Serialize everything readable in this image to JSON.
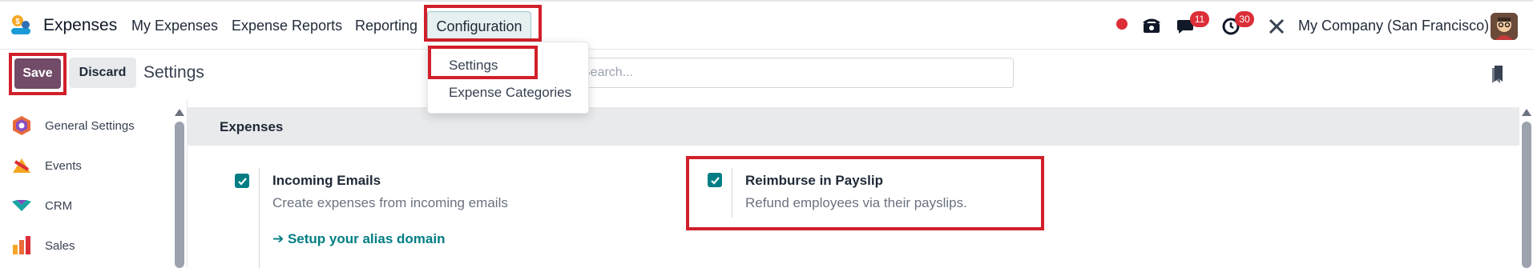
{
  "navbar": {
    "app_name": "Expenses",
    "menu": [
      "My Expenses",
      "Expense Reports",
      "Reporting"
    ],
    "active_menu": "Configuration",
    "messages_count": "11",
    "activities_count": "30",
    "company": "My Company (San Francisco)"
  },
  "control_panel": {
    "save_label": "Save",
    "discard_label": "Discard",
    "title": "Settings",
    "search_placeholder": "Search..."
  },
  "dropdown": {
    "items": [
      "Settings",
      "Expense Categories"
    ]
  },
  "sidebar": {
    "items": [
      {
        "label": "General Settings",
        "icon": "general-settings-icon"
      },
      {
        "label": "Events",
        "icon": "events-icon"
      },
      {
        "label": "CRM",
        "icon": "crm-icon"
      },
      {
        "label": "Sales",
        "icon": "sales-icon"
      }
    ]
  },
  "main": {
    "section_title": "Expenses",
    "settings": [
      {
        "title": "Incoming Emails",
        "description": "Create expenses from incoming emails",
        "link": "➔ Setup your alias domain",
        "checked": true
      },
      {
        "title": "Reimburse in Payslip",
        "description": "Refund employees via their payslips.",
        "checked": true
      }
    ]
  },
  "colors": {
    "primary": "#714b67",
    "accent": "#017e84",
    "highlight": "#d11f2a",
    "badge": "#dc2e38"
  }
}
